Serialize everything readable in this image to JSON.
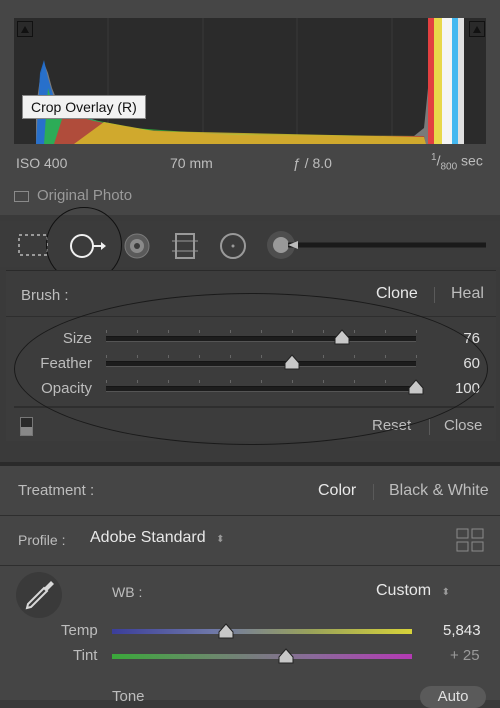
{
  "histogram": {
    "tooltip": "Crop Overlay (R)",
    "iso": "ISO 400",
    "focal": "70 mm",
    "aperture": "ƒ / 8.0",
    "shutter_num": "1",
    "shutter_den": "800",
    "shutter_unit": "sec",
    "original_photo": "Original Photo"
  },
  "tools": [
    "crop-overlay",
    "spot-removal",
    "red-eye",
    "graduated-filter",
    "radial-filter",
    "adjustment-brush"
  ],
  "brush": {
    "label": "Brush :",
    "clone": "Clone",
    "heal": "Heal",
    "sliders": [
      {
        "label": "Size",
        "value": "76",
        "pct": 0.76
      },
      {
        "label": "Feather",
        "value": "60",
        "pct": 0.6
      },
      {
        "label": "Opacity",
        "value": "100",
        "pct": 1.0
      }
    ],
    "reset": "Reset",
    "close": "Close"
  },
  "basic": {
    "treatment_label": "Treatment :",
    "color": "Color",
    "bw": "Black & White",
    "profile_label": "Profile :",
    "profile_value": "Adobe Standard",
    "wb_label": "WB :",
    "wb_value": "Custom",
    "temp_label": "Temp",
    "temp_value": "5,843",
    "temp_pct": 0.38,
    "tint_label": "Tint",
    "tint_value": "+ 25",
    "tint_pct": 0.58,
    "tone_label": "Tone",
    "auto_label": "Auto"
  },
  "colors": {
    "accent": "#e8e8e8",
    "panel": "#3c3c3c"
  }
}
